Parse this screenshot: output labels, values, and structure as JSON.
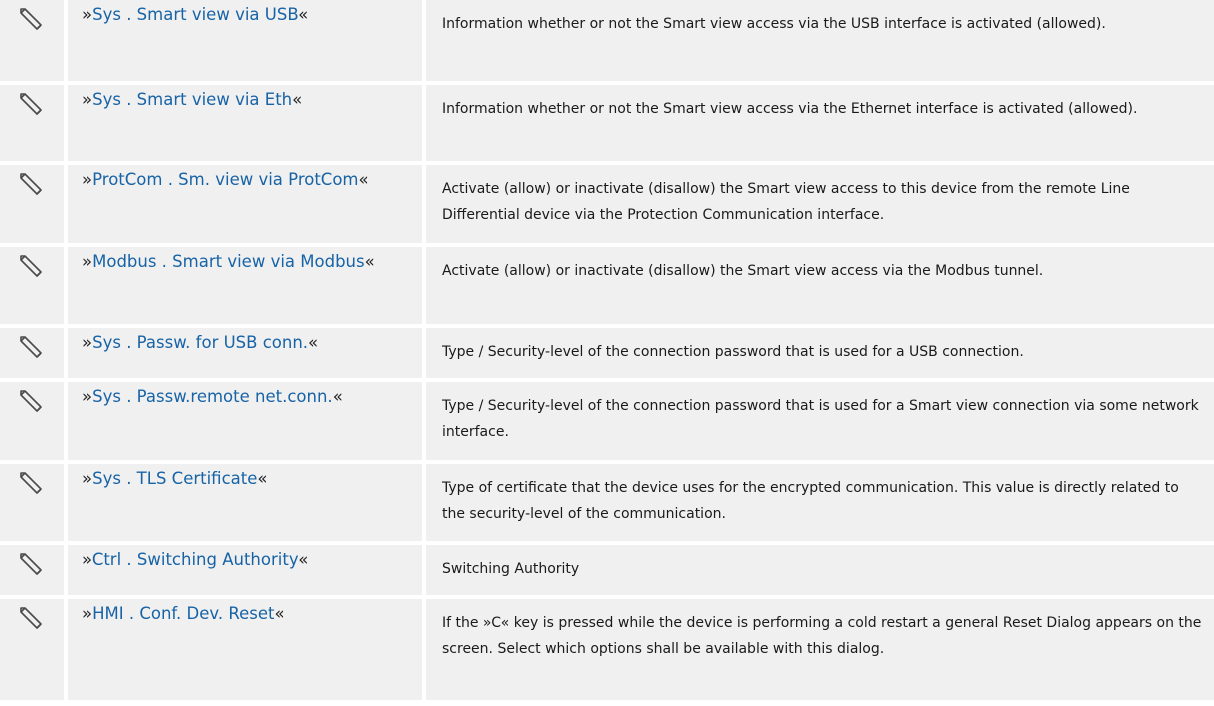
{
  "parameters": [
    {
      "icon": "pencil-icon",
      "prefix": "»",
      "name": "Sys . Smart view via USB",
      "suffix": "«",
      "description": "Information whether or not the Smart view access via the USB interface is activated (allowed)."
    },
    {
      "icon": "pencil-icon",
      "prefix": "»",
      "name": "Sys . Smart view via Eth",
      "suffix": "«",
      "description": "Information whether or not the Smart view access via the Ethernet interface is activated (allowed)."
    },
    {
      "icon": "pencil-icon",
      "prefix": "»",
      "name": "ProtCom . Sm. view via ProtCom",
      "suffix": "«",
      "description": "Activate (allow) or inactivate (disallow) the Smart view access to this device from the remote Line Differential device via the Protection Communication interface."
    },
    {
      "icon": "pencil-icon",
      "prefix": "»",
      "name": "Modbus . Smart view via Modbus",
      "suffix": "«",
      "description": "Activate (allow) or inactivate (disallow) the Smart view access via the Modbus tunnel."
    },
    {
      "icon": "pencil-icon",
      "prefix": "»",
      "name": "Sys . Passw. for USB conn.",
      "suffix": "«",
      "description": "Type / Security-level of the connection password that is used for a USB connection."
    },
    {
      "icon": "pencil-icon",
      "prefix": "»",
      "name": "Sys . Passw.remote net.conn.",
      "suffix": "«",
      "description": "Type / Security-level of the connection password that is used for a Smart view connection via some network interface."
    },
    {
      "icon": "pencil-icon",
      "prefix": "»",
      "name": "Sys . TLS Certificate",
      "suffix": "«",
      "description": "Type of certificate that the device uses for the encrypted communication. This value is directly related to the security-level of the communication."
    },
    {
      "icon": "pencil-icon",
      "prefix": "»",
      "name": "Ctrl . Switching Authority",
      "suffix": "«",
      "description": "Switching Authority"
    },
    {
      "icon": "pencil-icon",
      "prefix": "»",
      "name": "HMI . Conf. Dev. Reset",
      "suffix": "«",
      "description": "If the »C« key is pressed while the device is performing a cold restart a general Reset Dialog appears on the screen. Select which options shall be available with this dialog."
    }
  ]
}
